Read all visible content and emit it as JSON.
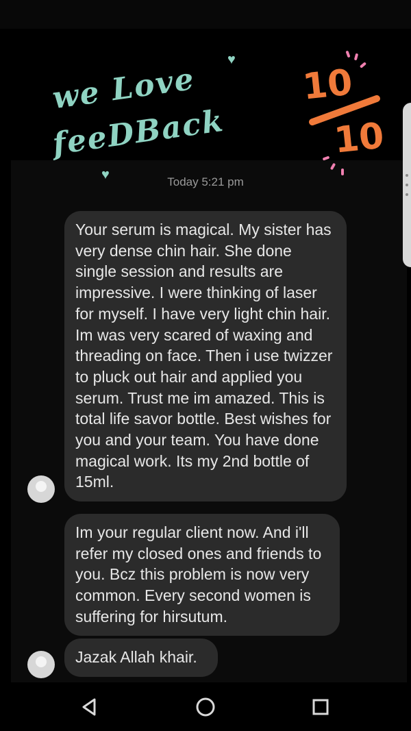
{
  "header": {
    "title_line1": "we Love",
    "title_line2": "feeDBack",
    "score_top": "10",
    "score_bottom": "10",
    "accent_colors": {
      "title": "#8fd3c2",
      "score": "#f07a3a",
      "sparkle": "#f080b0"
    }
  },
  "chat": {
    "timestamp": "Today 5:21 pm",
    "messages": [
      {
        "text": "Your serum is magical. My sister has very dense chin hair. She done single session and results are impressive. I were thinking of laser for myself. I have very light chin hair. Im was very scared of waxing and threading on face. Then i use twizzer to pluck out hair and applied you serum. Trust me im amazed. This is total life savor bottle. Best wishes for you and your team. You have done magical work. Its my 2nd bottle of 15ml."
      },
      {
        "text": "Im your regular client now. And i'll refer my closed ones and friends to you. Bcz this problem is now very common. Every second women is suffering for hirsutum."
      },
      {
        "text": "Jazak Allah khair."
      }
    ]
  },
  "navbar": {
    "icons": [
      "back-triangle-icon",
      "home-circle-icon",
      "recents-square-icon"
    ]
  }
}
